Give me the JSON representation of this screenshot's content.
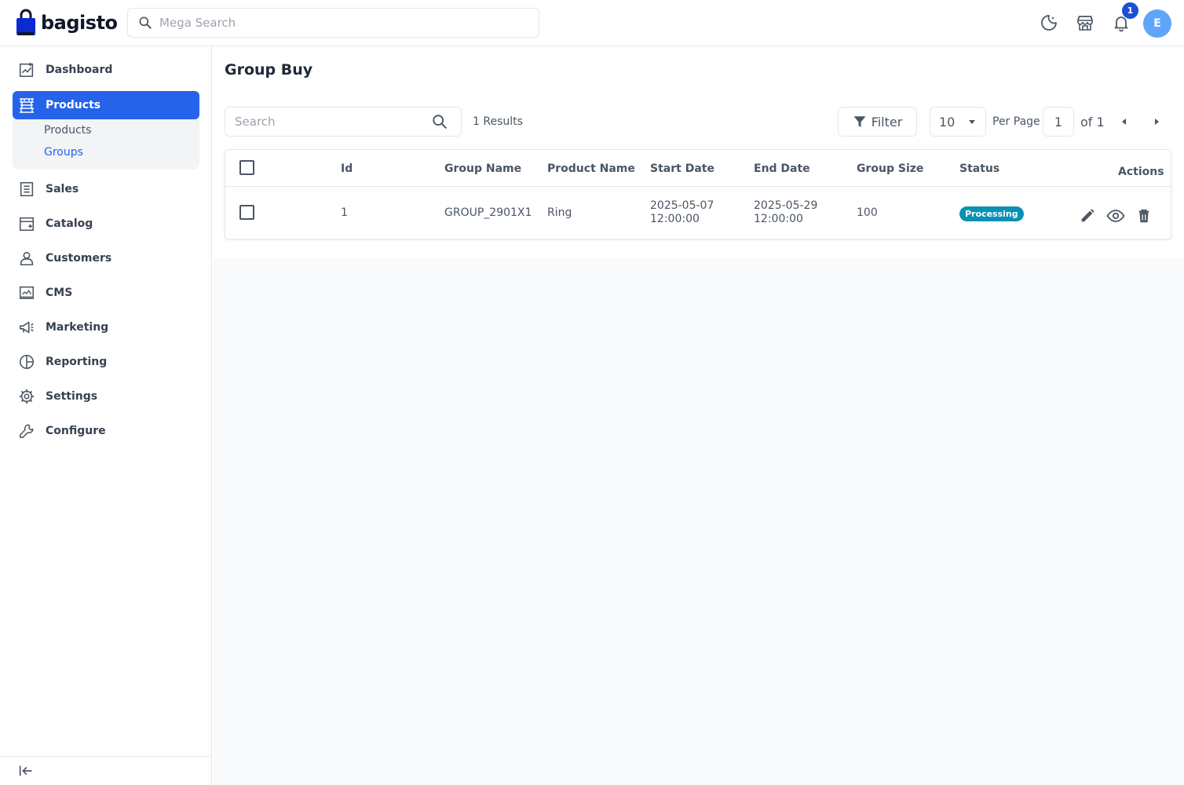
{
  "header": {
    "logo_text": "bagisto",
    "search_placeholder": "Mega Search",
    "notification_count": "1",
    "avatar_initial": "E",
    "brand_color": "#2563eb"
  },
  "sidebar": {
    "items": [
      {
        "label": "Dashboard",
        "icon": "dashboard-icon"
      },
      {
        "label": "Products",
        "icon": "products-icon",
        "active": true
      },
      {
        "label": "Sales",
        "icon": "sales-icon"
      },
      {
        "label": "Catalog",
        "icon": "catalog-icon"
      },
      {
        "label": "Customers",
        "icon": "customers-icon"
      },
      {
        "label": "CMS",
        "icon": "cms-icon"
      },
      {
        "label": "Marketing",
        "icon": "marketing-icon"
      },
      {
        "label": "Reporting",
        "icon": "reporting-icon"
      },
      {
        "label": "Settings",
        "icon": "settings-icon"
      },
      {
        "label": "Configure",
        "icon": "configure-icon"
      }
    ],
    "sub_items": [
      {
        "label": "Products"
      },
      {
        "label": "Groups",
        "selected": true
      }
    ]
  },
  "page": {
    "title": "Group Buy",
    "search_placeholder": "Search",
    "results": "1 Results",
    "filter_label": "Filter",
    "per_page_value": "10",
    "per_page_label": "Per Page",
    "current_page": "1",
    "of_pages": "of 1"
  },
  "table": {
    "columns": [
      "Id",
      "Group Name",
      "Product Name",
      "Start Date",
      "End Date",
      "Group Size",
      "Status",
      "Actions"
    ],
    "rows": [
      {
        "id": "1",
        "group_name": "GROUP_2901X1",
        "product_name": "Ring",
        "start_date": "2025-05-07",
        "start_time": "12:00:00",
        "end_date": "2025-05-29",
        "end_time": "12:00:00",
        "group_size": "100",
        "status": "Processing",
        "status_color": "#0891b2"
      }
    ]
  }
}
